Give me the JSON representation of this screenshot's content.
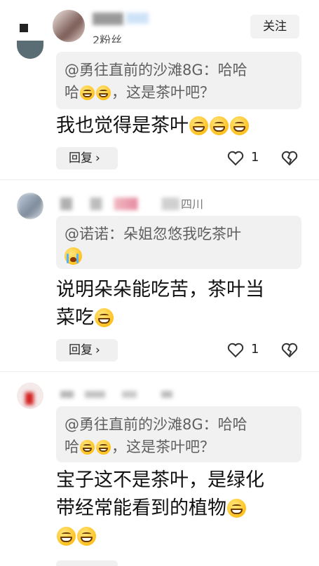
{
  "header": {
    "follow_label": "关注",
    "follower_count": "2粉丝"
  },
  "comments": [
    {
      "quote_author": "@勇往直前的沙滩8G",
      "quote_sep": "：",
      "quote_line1": "哈哈",
      "quote_line2_a": "哈",
      "quote_line2_b": "，这是茶叶吧？",
      "text": "我也觉得是茶叶",
      "reply_label": "回复",
      "like_count": "1"
    },
    {
      "location": "四川",
      "quote_author": "@诺诺",
      "quote_sep": "：",
      "quote_text": "朵姐忽悠我吃茶叶",
      "text_line1": "说明朵朵能吃苦，茶叶当",
      "text_line2": "菜吃",
      "reply_label": "回复",
      "like_count": "1"
    },
    {
      "quote_author": "@勇往直前的沙滩8G",
      "quote_sep": "：",
      "quote_line1": "哈哈",
      "quote_line2_a": "哈",
      "quote_line2_b": "，这是茶叶吧？",
      "text_line1": "宝子这不是茶叶，是绿化",
      "text_line2": "带经常能看到的植物"
    }
  ],
  "icons": [
    "back-icon",
    "heart-icon",
    "broken-heart-icon",
    "chevron-right-icon",
    "grin-emoji-icon",
    "crying-emoji-icon"
  ]
}
